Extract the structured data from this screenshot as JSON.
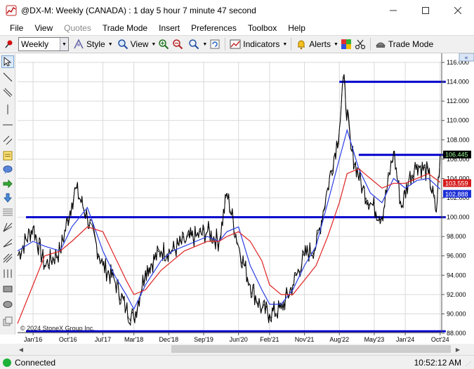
{
  "window": {
    "title": "@DX-M: Weekly (CANADA) : 1 day 5 hour 7 minute 47 second",
    "minimize_icon": "minimize-icon",
    "maximize_icon": "maximize-icon",
    "close_icon": "close-icon"
  },
  "menu": [
    "File",
    "View",
    "Quotes",
    "Trade Mode",
    "Insert",
    "Preferences",
    "Toolbox",
    "Help"
  ],
  "menu_disabled": [
    "Quotes"
  ],
  "toolbar": {
    "period": "Weekly",
    "style_label": "Style",
    "view_label": "View",
    "indicators_label": "Indicators",
    "alerts_label": "Alerts",
    "trade_mode_label": "Trade Mode"
  },
  "left_tools": [
    "pointer-icon",
    "line-icon",
    "parallel-lines-icon",
    "vertical-line-icon",
    "horizontal-line-icon",
    "channel-icon",
    "note-icon",
    "callout-icon",
    "arrow-right-icon",
    "arrow-down-icon",
    "fibonacci-icon",
    "gann-fan-icon",
    "speed-lines-icon",
    "andrews-pitchfork-icon",
    "cycle-lines-icon",
    "rectangle-icon",
    "ellipse-icon",
    "template-icon"
  ],
  "chart": {
    "copyright": "© 2024 StoneX Group Inc.",
    "colors": {
      "price": "#000000",
      "fast_ma": "#2a3fe6",
      "slow_ma": "#e02020",
      "horizontal_lines": "#0000cc",
      "last_price_bg": "#000000",
      "fast_label_bg": "#1c2fd6",
      "slow_label_bg": "#d61c1c"
    }
  },
  "status": {
    "connection": "Connected",
    "time": "10:52:12 AM"
  },
  "chart_data": {
    "type": "line",
    "title": "",
    "xlabel": "",
    "ylabel": "",
    "x_ticks": [
      "Jan'16",
      "Oct'16",
      "Jul'17",
      "Mar'18",
      "Dec'18",
      "Sep'19",
      "Jun'20",
      "Feb'21",
      "Nov'21",
      "Aug'22",
      "May'23",
      "Jan'24",
      "Oct'24"
    ],
    "y_ticks": [
      "116.000",
      "114.000",
      "112.000",
      "110.000",
      "108.000",
      "106.000",
      "104.000",
      "102.000",
      "100.000",
      "98.000",
      "96.000",
      "94.000",
      "92.000",
      "90.000",
      "88.000"
    ],
    "ylim": [
      88,
      116
    ],
    "grid": true,
    "price_labels": [
      {
        "text": "106.445",
        "value": 106.445,
        "role": "last"
      },
      {
        "text": "103.559",
        "value": 103.559,
        "role": "slow-ma"
      },
      {
        "text": "102.888",
        "value": 102.888,
        "role": "fast-ma"
      }
    ],
    "horizontal_lines": [
      {
        "value": 114.0,
        "from": "Aug'22",
        "to": "Oct'24"
      },
      {
        "value": 106.445,
        "from": "Jan'23",
        "to": "Oct'24"
      },
      {
        "value": 100.0,
        "from": "Sep'15",
        "to": "Oct'24"
      },
      {
        "value": 88.2,
        "from": "Sep'15",
        "to": "Oct'24"
      }
    ],
    "series": [
      {
        "role": "price",
        "x": [
          "Sep'15",
          "Jan'16",
          "Apr'16",
          "Aug'16",
          "Nov'16",
          "Dec'16",
          "Mar'17",
          "Jul'17",
          "Oct'17",
          "Jan'18",
          "Mar'18",
          "Jun'18",
          "Oct'18",
          "Jan'19",
          "Apr'19",
          "Jul'19",
          "Oct'19",
          "Jan'20",
          "Mar'20",
          "Jun'20",
          "Sep'20",
          "Dec'20",
          "Feb'21",
          "May'21",
          "Aug'21",
          "Nov'21",
          "Feb'22",
          "May'22",
          "Aug'22",
          "Sep'22",
          "Nov'22",
          "Feb'23",
          "Apr'23",
          "Jul'23",
          "Oct'23",
          "Dec'23",
          "Feb'24",
          "Apr'24",
          "Jul'24",
          "Sep'24",
          "Oct'24"
        ],
        "values": [
          96.0,
          99.0,
          95.0,
          96.5,
          101.5,
          103.0,
          100.0,
          95.0,
          93.5,
          90.5,
          89.5,
          94.5,
          96.5,
          96.5,
          97.5,
          98.0,
          98.5,
          97.5,
          102.5,
          97.0,
          93.0,
          90.5,
          90.0,
          90.5,
          93.0,
          96.0,
          97.0,
          103.0,
          109.0,
          114.5,
          107.0,
          103.0,
          101.5,
          100.0,
          106.8,
          101.0,
          104.0,
          105.5,
          104.5,
          100.5,
          106.4
        ]
      },
      {
        "role": "fast-ma",
        "x": [
          "Sep'15",
          "Jan'16",
          "Apr'16",
          "Aug'16",
          "Nov'16",
          "Mar'17",
          "Jul'17",
          "Oct'17",
          "Jan'18",
          "Mar'18",
          "Jun'18",
          "Oct'18",
          "Jan'19",
          "Apr'19",
          "Jul'19",
          "Oct'19",
          "Jan'20",
          "Mar'20",
          "Jun'20",
          "Sep'20",
          "Dec'20",
          "Feb'21",
          "May'21",
          "Aug'21",
          "Nov'21",
          "Feb'22",
          "May'22",
          "Aug'22",
          "Oct'22",
          "Jan'23",
          "Apr'23",
          "Jul'23",
          "Oct'23",
          "Jan'24",
          "Apr'24",
          "Jul'24",
          "Oct'24"
        ],
        "values": [
          96.5,
          97.5,
          97.0,
          96.5,
          99.0,
          101.0,
          96.5,
          94.0,
          92.0,
          90.5,
          93.0,
          95.5,
          96.5,
          97.0,
          97.5,
          98.0,
          97.5,
          98.5,
          99.0,
          95.0,
          92.5,
          91.0,
          91.0,
          92.5,
          95.0,
          97.0,
          101.5,
          106.0,
          109.0,
          105.0,
          102.5,
          101.5,
          104.0,
          103.0,
          103.8,
          104.0,
          102.9
        ]
      },
      {
        "role": "slow-ma",
        "x": [
          "Sep'15",
          "Jan'16",
          "Apr'16",
          "Aug'16",
          "Nov'16",
          "Mar'17",
          "Jul'17",
          "Oct'17",
          "Jan'18",
          "Mar'18",
          "Jun'18",
          "Oct'18",
          "Jan'19",
          "Apr'19",
          "Jul'19",
          "Oct'19",
          "Jan'20",
          "Mar'20",
          "Jun'20",
          "Sep'20",
          "Dec'20",
          "Feb'21",
          "May'21",
          "Aug'21",
          "Nov'21",
          "Feb'22",
          "May'22",
          "Aug'22",
          "Oct'22",
          "Jan'23",
          "Apr'23",
          "Jul'23",
          "Oct'23",
          "Jan'24",
          "Apr'24",
          "Jul'24",
          "Oct'24"
        ],
        "values": [
          89.0,
          93.0,
          96.0,
          96.5,
          97.5,
          99.0,
          98.5,
          96.0,
          93.5,
          92.0,
          92.5,
          94.5,
          95.5,
          96.5,
          97.0,
          97.5,
          97.5,
          98.0,
          98.5,
          97.5,
          95.5,
          93.0,
          92.0,
          92.0,
          93.5,
          95.0,
          98.0,
          101.5,
          104.5,
          105.0,
          104.0,
          103.0,
          103.5,
          103.5,
          104.0,
          104.5,
          103.6
        ]
      }
    ]
  }
}
